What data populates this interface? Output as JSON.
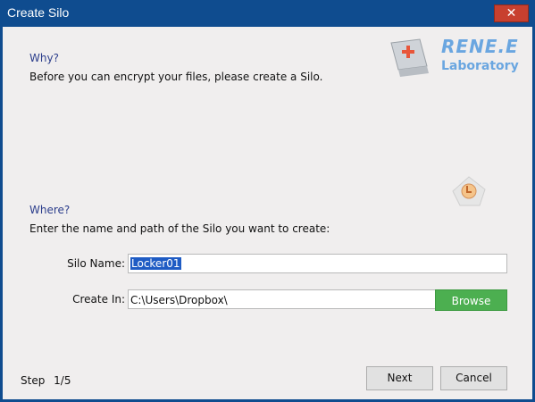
{
  "window": {
    "title": "Create Silo",
    "close_glyph": "✕"
  },
  "logo": {
    "top": "RENE.E",
    "bottom": "Laboratory"
  },
  "why": {
    "heading": "Why?",
    "text": "Before you can encrypt your files, please create a Silo."
  },
  "where": {
    "heading": "Where?",
    "text": "Enter the name and path of the Silo you want to create:"
  },
  "form": {
    "silo_name_label": "Silo Name:",
    "silo_name_value": "Locker01",
    "create_in_label": "Create In:",
    "create_in_value": "C:\\Users\\Dropbox\\",
    "browse_label": "Browse"
  },
  "footer": {
    "step_label": "Step",
    "step_value": "1/5",
    "next_label": "Next",
    "cancel_label": "Cancel"
  },
  "colors": {
    "titlebar": "#0f4c8f",
    "heading": "#2c3e8c",
    "browse": "#4caf50",
    "selection": "#1f5cc4"
  },
  "icons": [
    "close-icon",
    "plus-key-icon",
    "shield-clock-icon"
  ]
}
